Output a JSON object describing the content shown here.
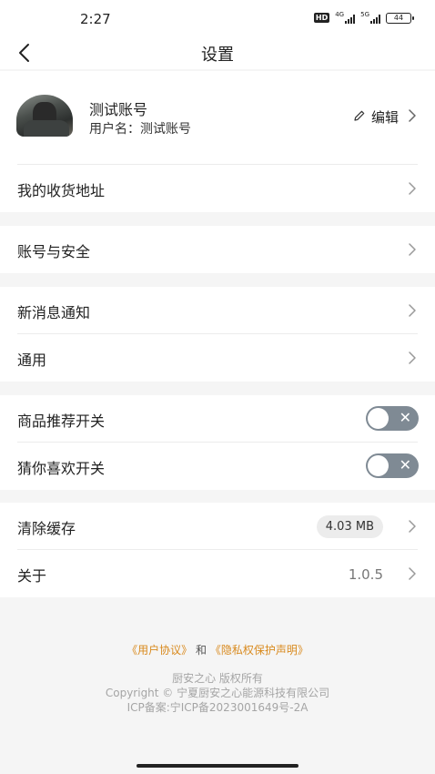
{
  "status_bar": {
    "time": "2:27",
    "hd_label": "HD",
    "network_1": "4G",
    "network_2": "5G",
    "battery": "44"
  },
  "header": {
    "title": "设置"
  },
  "profile": {
    "nickname": "测试账号",
    "username": "用户名：测试账号",
    "edit_label": "编辑"
  },
  "menu": {
    "address": "我的收货地址",
    "account_security": "账号与安全",
    "notifications": "新消息通知",
    "general": "通用",
    "recommend_switch": "商品推荐开关",
    "guess_like_switch": "猜你喜欢开关",
    "clear_cache": "清除缓存",
    "cache_size": "4.03 MB",
    "about": "关于",
    "version": "1.0.5"
  },
  "toggles": {
    "recommend_on": false,
    "guess_like_on": false,
    "off_symbol": "✕"
  },
  "footer": {
    "user_agreement": "《用户协议》",
    "and_text": "和",
    "privacy_policy": "《隐私权保护声明》",
    "copyright_line1": "厨安之心 版权所有",
    "copyright_line2": "Copyright © 宁夏厨安之心能源科技有限公司",
    "icp": "ICP备案:宁ICP备2023001649号-2A"
  },
  "colors": {
    "accent_link": "#d98a1e",
    "toggle_off": "#7f8a94"
  }
}
